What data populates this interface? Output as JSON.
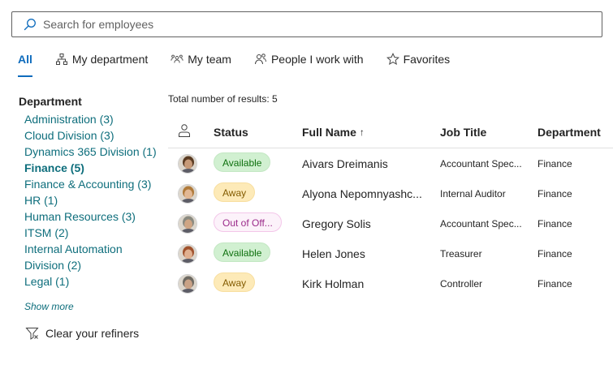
{
  "search": {
    "placeholder": "Search for employees",
    "icon": "search-icon"
  },
  "tabs": [
    {
      "label": "All",
      "icon": "",
      "active": true
    },
    {
      "label": "My department",
      "icon": "org-chart-icon",
      "active": false
    },
    {
      "label": "My team",
      "icon": "people-team-icon",
      "active": false
    },
    {
      "label": "People I work with",
      "icon": "people-icon",
      "active": false
    },
    {
      "label": "Favorites",
      "icon": "star-icon",
      "active": false
    }
  ],
  "refiners": {
    "heading": "Department",
    "items": [
      {
        "label": "Administration (3)",
        "selected": false
      },
      {
        "label": "Cloud Division (3)",
        "selected": false
      },
      {
        "label": "Dynamics 365 Division (1)",
        "selected": false
      },
      {
        "label": "Finance (5)",
        "selected": true
      },
      {
        "label": "Finance & Accounting (3)",
        "selected": false
      },
      {
        "label": "HR (1)",
        "selected": false
      },
      {
        "label": "Human Resources (3)",
        "selected": false
      },
      {
        "label": "ITSM (2)",
        "selected": false
      },
      {
        "label": "Internal Automation Division (2)",
        "selected": false
      },
      {
        "label": "Legal (1)",
        "selected": false
      }
    ],
    "show_more": "Show more",
    "clear": "Clear your refiners"
  },
  "results": {
    "total": "Total number of results: 5",
    "columns": {
      "status": "Status",
      "name": "Full Name",
      "sort": "↑",
      "job": "Job Title",
      "department": "Department"
    },
    "rows": [
      {
        "status": "Available",
        "status_type": "available",
        "name": "Aivars Dreimanis",
        "job": "Accountant Spec...",
        "department": "Finance",
        "skin": "#c79a78",
        "hair": "#5a3b22"
      },
      {
        "status": "Away",
        "status_type": "away",
        "name": "Alyona Nepomnyashc...",
        "job": "Internal Auditor",
        "department": "Finance",
        "skin": "#e2b894",
        "hair": "#b07a3a"
      },
      {
        "status": "Out of Off...",
        "status_type": "ooo",
        "name": "Gregory Solis",
        "job": "Accountant Spec...",
        "department": "Finance",
        "skin": "#cfa584",
        "hair": "#8a8a80"
      },
      {
        "status": "Available",
        "status_type": "available",
        "name": "Helen Jones",
        "job": "Treasurer",
        "department": "Finance",
        "skin": "#e0b090",
        "hair": "#a0522d"
      },
      {
        "status": "Away",
        "status_type": "away",
        "name": "Kirk Holman",
        "job": "Controller",
        "department": "Finance",
        "skin": "#c9a286",
        "hair": "#6e6a62"
      }
    ]
  },
  "colors": {
    "accent": "#0f6cbd",
    "refiner_link": "#0e6e7c"
  }
}
